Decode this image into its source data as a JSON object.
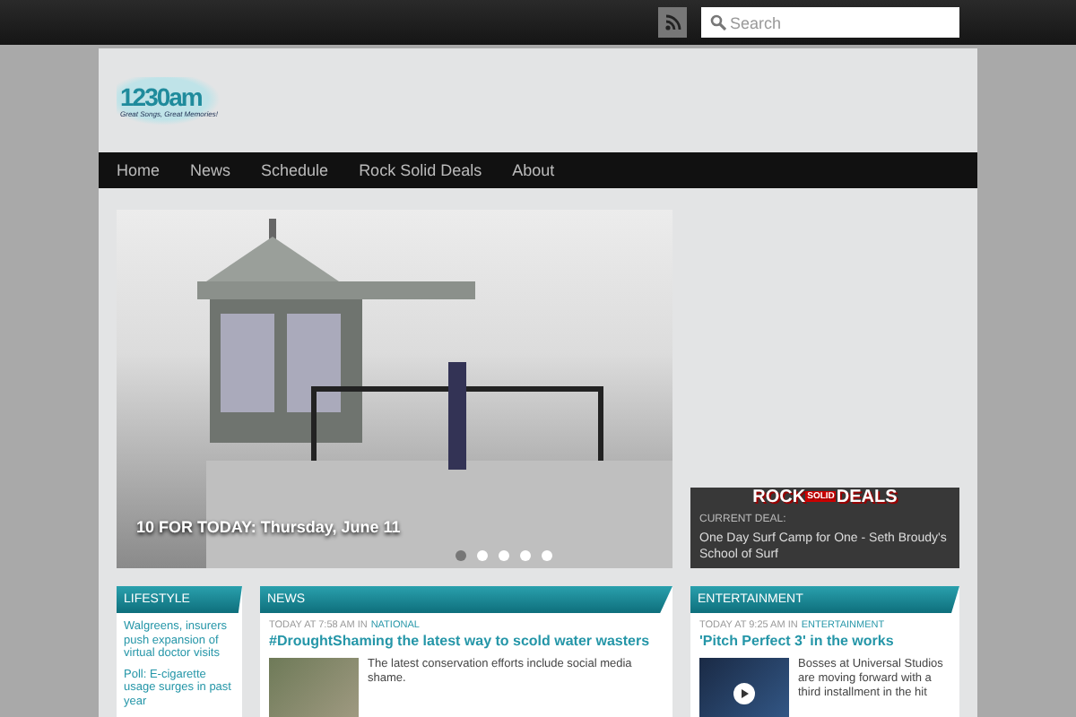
{
  "top_bar": {
    "search": {
      "placeholder": "Search"
    }
  },
  "logo": {
    "name": "1230am",
    "tagline": "Great Songs, Great Memories!"
  },
  "nav": {
    "items": [
      {
        "label": "Home",
        "selected": false
      },
      {
        "label": "News",
        "selected": false
      },
      {
        "label": "Schedule",
        "selected": false
      },
      {
        "label": "Rock Solid Deals",
        "selected": false
      },
      {
        "label": "About",
        "selected": false
      }
    ]
  },
  "slider": {
    "caption": "10 FOR TODAY: Thursday, June 11",
    "dots": [
      {
        "selected": true
      },
      {
        "selected": false
      },
      {
        "selected": false
      },
      {
        "selected": false
      },
      {
        "selected": false
      }
    ]
  },
  "deals": {
    "logo": [
      "ROCK",
      "SOLID",
      "DEALS"
    ],
    "label": "CURRENT DEAL:",
    "deal": "One Day Surf Camp for One - Seth Broudy's School of Surf"
  },
  "lifestyle": {
    "title": "LIFESTYLE",
    "links": [
      "Walgreens, insurers push expansion of virtual doctor visits",
      "Poll: E-cigarette usage surges in past year"
    ]
  },
  "news": {
    "title": "NEWS",
    "meta": "TODAY AT 7:58 AM IN",
    "category": "NATIONAL",
    "headline": "#DroughtShaming the latest way to scold water wasters",
    "summary": "The latest conservation efforts include social media shame."
  },
  "entertainment": {
    "title": "ENTERTAINMENT",
    "meta": "TODAY AT 9:25 AM IN",
    "category": "ENTERTAINMENT",
    "headline": "'Pitch Perfect 3' in the works",
    "summary": "Bosses at Universal Studios are moving forward with a third installment in the hit"
  }
}
